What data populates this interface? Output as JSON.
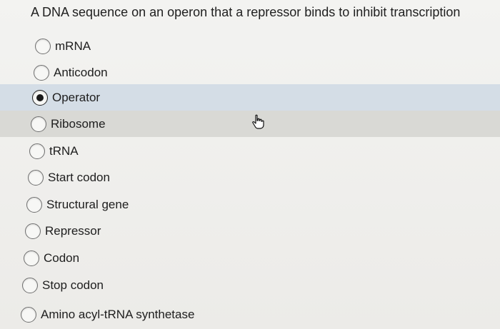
{
  "question": {
    "text": "A DNA sequence on an operon that a repressor binds to inhibit transcription"
  },
  "options": [
    {
      "label": "mRNA",
      "selected": false
    },
    {
      "label": "Anticodon",
      "selected": false
    },
    {
      "label": "Operator",
      "selected": true
    },
    {
      "label": "Ribosome",
      "selected": false
    },
    {
      "label": "tRNA",
      "selected": false
    },
    {
      "label": "Start codon",
      "selected": false
    },
    {
      "label": "Structural gene",
      "selected": false
    },
    {
      "label": "Repressor",
      "selected": false
    },
    {
      "label": "Codon",
      "selected": false
    },
    {
      "label": "Stop codon",
      "selected": false
    },
    {
      "label": "Amino acyl-tRNA synthetase",
      "selected": false
    }
  ],
  "cursor": {
    "icon": "hand-pointer-icon"
  },
  "colors": {
    "selected_row": "#d4dde6",
    "hover_row": "#d9d9d5",
    "background": "#efefec"
  }
}
